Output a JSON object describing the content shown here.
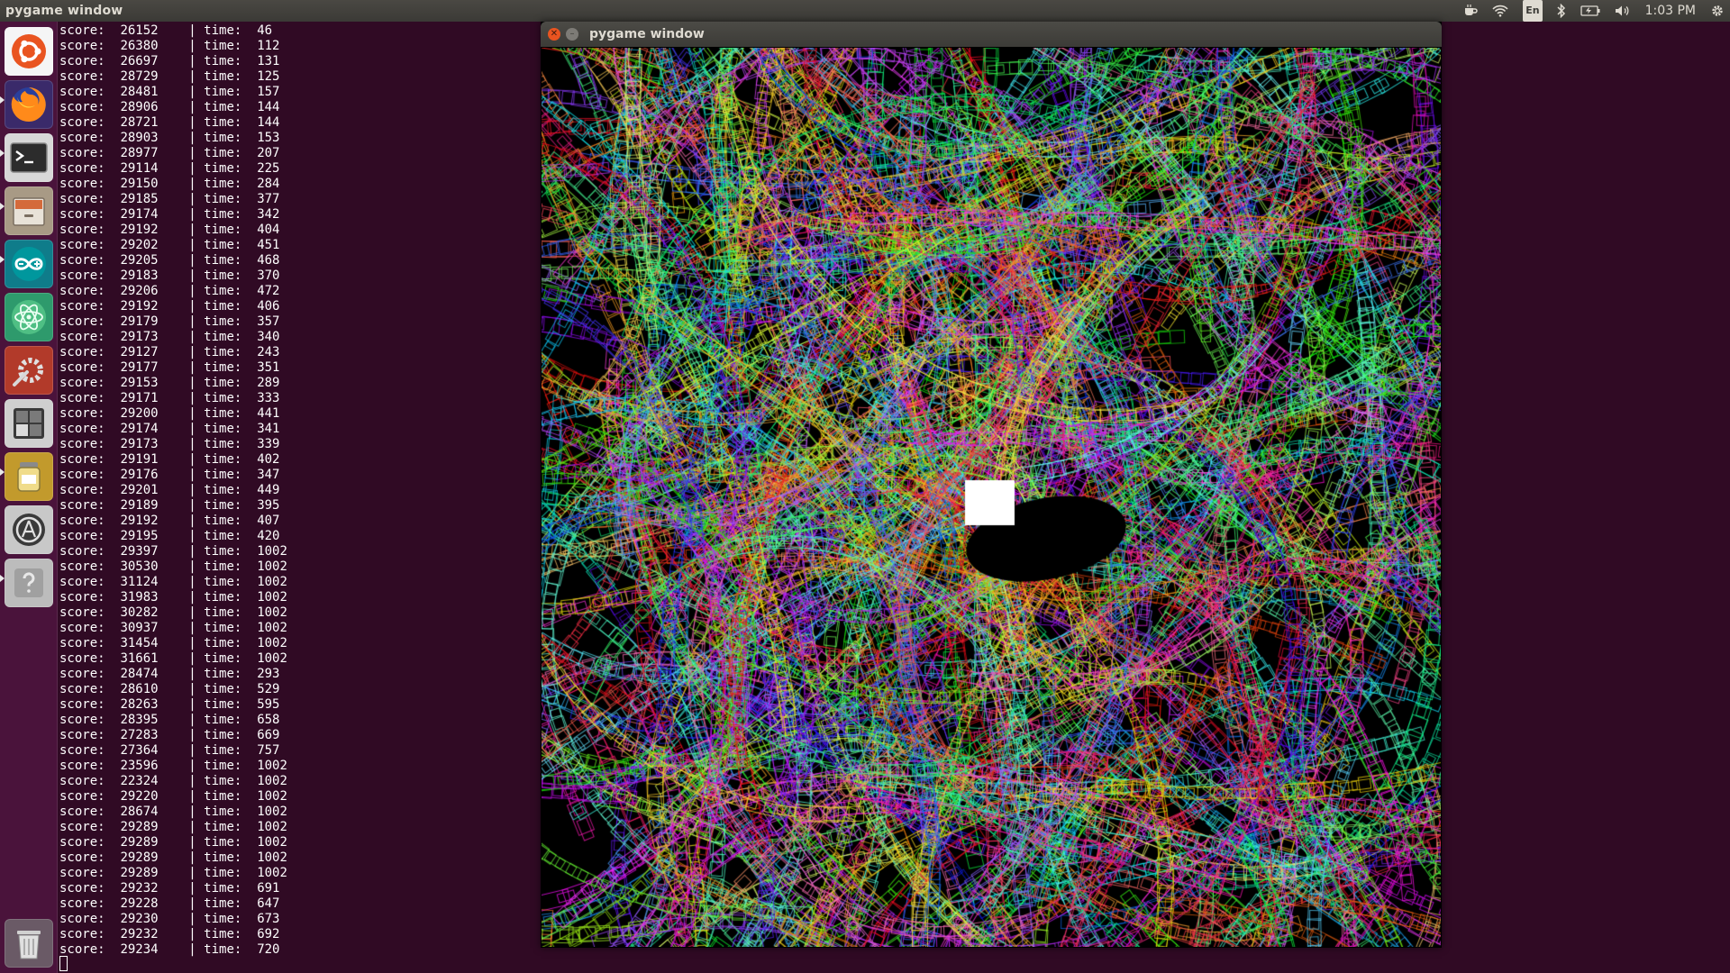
{
  "top_panel": {
    "title": "pygame window",
    "keyboard_layout": "En",
    "clock": "1:03 PM"
  },
  "launcher": {
    "items": [
      {
        "name": "ubuntu-dash",
        "icon": "ubuntu-logo-icon"
      },
      {
        "name": "firefox",
        "icon": "firefox-icon"
      },
      {
        "name": "terminal",
        "icon": "terminal-icon"
      },
      {
        "name": "files",
        "icon": "file-cabinet-icon"
      },
      {
        "name": "arduino",
        "icon": "arduino-icon"
      },
      {
        "name": "atom",
        "icon": "atom-icon"
      },
      {
        "name": "system-settings",
        "icon": "wrench-gear-icon"
      },
      {
        "name": "workspace-switcher",
        "icon": "workspaces-icon"
      },
      {
        "name": "backup",
        "icon": "jar-icon"
      },
      {
        "name": "software-updater",
        "icon": "updater-icon"
      },
      {
        "name": "help",
        "icon": "question-icon"
      },
      {
        "name": "trash",
        "icon": "trash-icon"
      }
    ]
  },
  "terminal": {
    "lines": [
      {
        "score": "26152",
        "time": "46"
      },
      {
        "score": "26380",
        "time": "112"
      },
      {
        "score": "26697",
        "time": "131"
      },
      {
        "score": "28729",
        "time": "125"
      },
      {
        "score": "28481",
        "time": "157"
      },
      {
        "score": "28906",
        "time": "144"
      },
      {
        "score": "28721",
        "time": "144"
      },
      {
        "score": "28903",
        "time": "153"
      },
      {
        "score": "28977",
        "time": "207"
      },
      {
        "score": "29114",
        "time": "225"
      },
      {
        "score": "29150",
        "time": "284"
      },
      {
        "score": "29185",
        "time": "377"
      },
      {
        "score": "29174",
        "time": "342"
      },
      {
        "score": "29192",
        "time": "404"
      },
      {
        "score": "29202",
        "time": "451"
      },
      {
        "score": "29205",
        "time": "468"
      },
      {
        "score": "29183",
        "time": "370"
      },
      {
        "score": "29206",
        "time": "472"
      },
      {
        "score": "29192",
        "time": "406"
      },
      {
        "score": "29179",
        "time": "357"
      },
      {
        "score": "29173",
        "time": "340"
      },
      {
        "score": "29127",
        "time": "243"
      },
      {
        "score": "29177",
        "time": "351"
      },
      {
        "score": "29153",
        "time": "289"
      },
      {
        "score": "29171",
        "time": "333"
      },
      {
        "score": "29200",
        "time": "441"
      },
      {
        "score": "29174",
        "time": "341"
      },
      {
        "score": "29173",
        "time": "339"
      },
      {
        "score": "29191",
        "time": "402"
      },
      {
        "score": "29176",
        "time": "347"
      },
      {
        "score": "29201",
        "time": "449"
      },
      {
        "score": "29189",
        "time": "395"
      },
      {
        "score": "29192",
        "time": "407"
      },
      {
        "score": "29195",
        "time": "420"
      },
      {
        "score": "29397",
        "time": "1002"
      },
      {
        "score": "30530",
        "time": "1002"
      },
      {
        "score": "31124",
        "time": "1002"
      },
      {
        "score": "31983",
        "time": "1002"
      },
      {
        "score": "30282",
        "time": "1002"
      },
      {
        "score": "30937",
        "time": "1002"
      },
      {
        "score": "31454",
        "time": "1002"
      },
      {
        "score": "31661",
        "time": "1002"
      },
      {
        "score": "28474",
        "time": "293"
      },
      {
        "score": "28610",
        "time": "529"
      },
      {
        "score": "28263",
        "time": "595"
      },
      {
        "score": "28395",
        "time": "658"
      },
      {
        "score": "27283",
        "time": "669"
      },
      {
        "score": "27364",
        "time": "757"
      },
      {
        "score": "23596",
        "time": "1002"
      },
      {
        "score": "22324",
        "time": "1002"
      },
      {
        "score": "29220",
        "time": "1002"
      },
      {
        "score": "28674",
        "time": "1002"
      },
      {
        "score": "29289",
        "time": "1002"
      },
      {
        "score": "29289",
        "time": "1002"
      },
      {
        "score": "29289",
        "time": "1002"
      },
      {
        "score": "29289",
        "time": "1002"
      },
      {
        "score": "29232",
        "time": "691"
      },
      {
        "score": "29228",
        "time": "647"
      },
      {
        "score": "29230",
        "time": "673"
      },
      {
        "score": "29232",
        "time": "692"
      },
      {
        "score": "29234",
        "time": "720"
      }
    ]
  },
  "pygame_window": {
    "title": "pygame window",
    "background": "#000000"
  }
}
